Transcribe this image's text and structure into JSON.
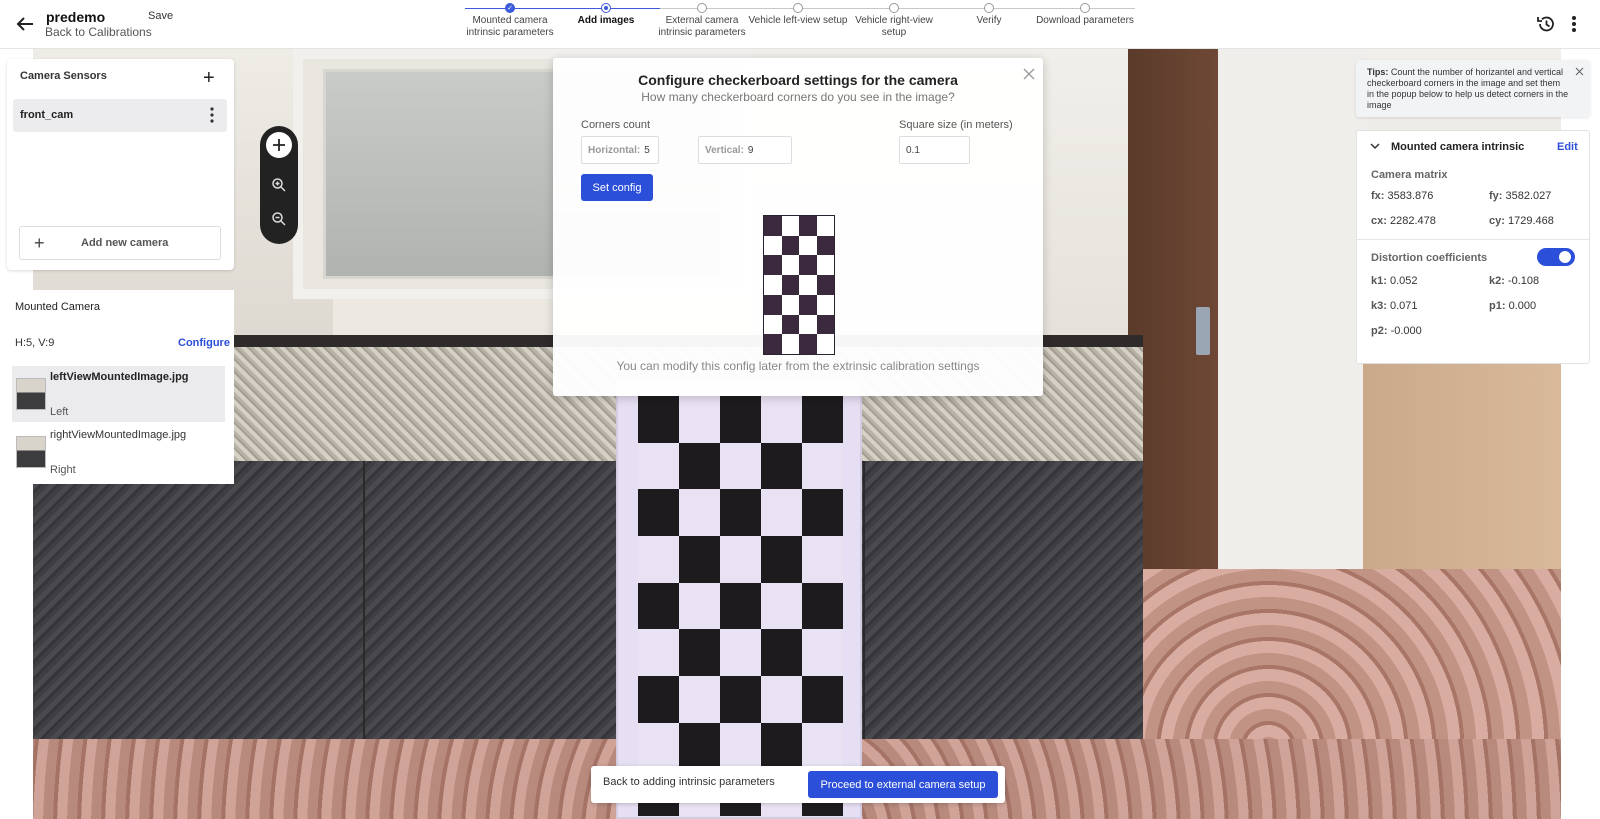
{
  "header": {
    "title": "predemo",
    "save_label": "Save",
    "back_label": "Back to Calibrations",
    "steps": [
      {
        "label": "Mounted camera intrinsic parameters",
        "state": "done"
      },
      {
        "label": "Add images",
        "state": "current"
      },
      {
        "label": "External camera intrinsic parameters",
        "state": "todo"
      },
      {
        "label": "Vehicle left-view setup",
        "state": "todo"
      },
      {
        "label": "Vehicle right-view setup",
        "state": "todo"
      },
      {
        "label": "Verify",
        "state": "todo"
      },
      {
        "label": "Download parameters",
        "state": "todo"
      }
    ]
  },
  "sensors": {
    "title": "Camera Sensors",
    "camera": "front_cam",
    "add_label": "Add new camera"
  },
  "mounted": {
    "title": "Mounted Camera",
    "hv": "H:5, V:9",
    "configure_label": "Configure",
    "images": [
      {
        "name": "leftViewMountedImage.jpg",
        "view": "Left",
        "selected": true
      },
      {
        "name": "rightViewMountedImage.jpg",
        "view": "Right",
        "selected": false
      }
    ]
  },
  "modal": {
    "title": "Configure checkerboard settings for the camera",
    "subtitle": "How many checkerboard corners do you see in the image?",
    "corners_label": "Corners count",
    "horizontal_label": "Horizontal:",
    "horizontal_value": "5",
    "vertical_label": "Vertical:",
    "vertical_value": "9",
    "square_label": "Square size (in meters)",
    "square_value": "0.1",
    "set_label": "Set config",
    "footer": "You can modify this config later from the extrinsic calibration settings"
  },
  "tips": {
    "prefix": "Tips:",
    "text": "Count the number of horizantel and vertical checkerboard corners in the image and set them in the popup below to help us detect corners in the image"
  },
  "intrinsic": {
    "title": "Mounted camera intrinsic",
    "edit_label": "Edit",
    "matrix_label": "Camera matrix",
    "fx_label": "fx:",
    "fx": "3583.876",
    "fy_label": "fy:",
    "fy": "3582.027",
    "cx_label": "cx:",
    "cx": "2282.478",
    "cy_label": "cy:",
    "cy": "1729.468",
    "dist_label": "Distortion coefficients",
    "dist_enabled": true,
    "k1_label": "k1:",
    "k1": "0.052",
    "k2_label": "k2:",
    "k2": "-0.108",
    "k3_label": "k3:",
    "k3": "0.071",
    "p1_label": "p1:",
    "p1": "0.000",
    "p2_label": "p2:",
    "p2": "-0.000"
  },
  "footer": {
    "back_label": "Back to adding intrinsic parameters",
    "proceed_label": "Proceed to external camera setup"
  },
  "colors": {
    "accent": "#2b4fd8"
  }
}
